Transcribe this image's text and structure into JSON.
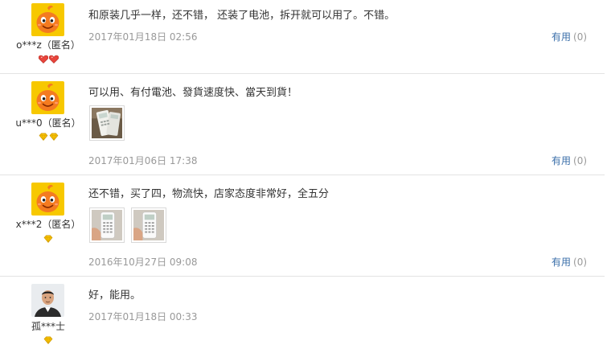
{
  "reviews": [
    {
      "username": "o***z（匿名）",
      "avatar": "orange-mascot-avatar",
      "badge": "red-heart-level",
      "content": "和原装几乎一样，还不错，  还装了电池，拆开就可以用了。不错。",
      "date": "2017年01月18日 02:56",
      "useful_label": "有用",
      "useful_count": "(0)",
      "images": []
    },
    {
      "username": "u***0（匿名）",
      "avatar": "orange-mascot-avatar",
      "badge": "yellow-diamond-level",
      "content": "可以用、有付電池、發貨速度快、當天到貨！",
      "date": "2017年01月06日 17:38",
      "useful_label": "有用",
      "useful_count": "(0)",
      "images": [
        "remote-control-photo"
      ]
    },
    {
      "username": "x***2（匿名）",
      "avatar": "orange-mascot-avatar",
      "badge": "yellow-diamond-level",
      "content": "还不错，买了四，物流快，店家态度非常好，全五分",
      "date": "2016年10月27日 09:08",
      "useful_label": "有用",
      "useful_count": "(0)",
      "images": [
        "remote-control-photo",
        "remote-control-photo"
      ]
    },
    {
      "username": "孤***士",
      "avatar": "person-photo-avatar",
      "badge": "yellow-diamond-level",
      "content": "好，能用。",
      "date": "2017年01月18日 00:33",
      "images": []
    }
  ],
  "colors": {
    "link": "#3b6faa",
    "meta": "#999999",
    "divider": "#e3e3e3",
    "mascot_bg": "#f7c800",
    "mascot": "#f47b20"
  }
}
